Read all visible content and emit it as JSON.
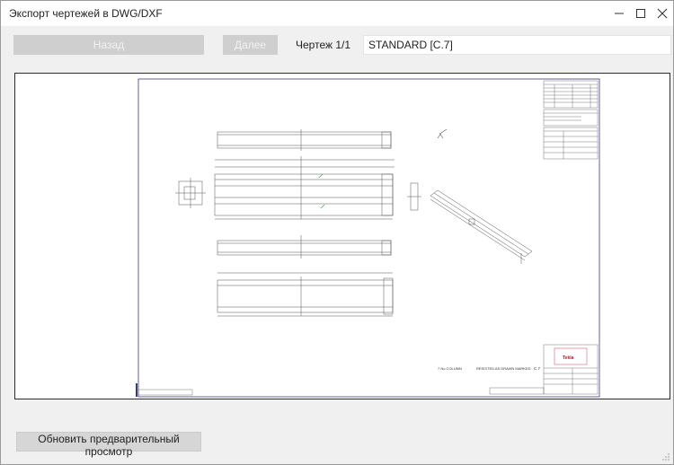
{
  "window": {
    "title": "Экспорт чертежей в DWG/DXF"
  },
  "toolbar": {
    "back_label": "Назад",
    "next_label": "Далее",
    "drawing_label": "Чертеж 1/1",
    "drawing_value": "STANDARD [C.7]"
  },
  "preview": {
    "sheet_labels": {
      "mark": "7 No  COLUMN",
      "status": "RESISTED AS DRAWN MARKED",
      "revision": "C.7",
      "logo": "Tekla"
    }
  },
  "footer": {
    "refresh_label": "Обновить предварительный просмотр"
  },
  "icons": {
    "minimize": "minimize-icon",
    "maximize": "maximize-icon",
    "close": "close-icon"
  },
  "colors": {
    "accent": "#c8102e",
    "frame": "#3a3a7a",
    "line": "#555555"
  }
}
